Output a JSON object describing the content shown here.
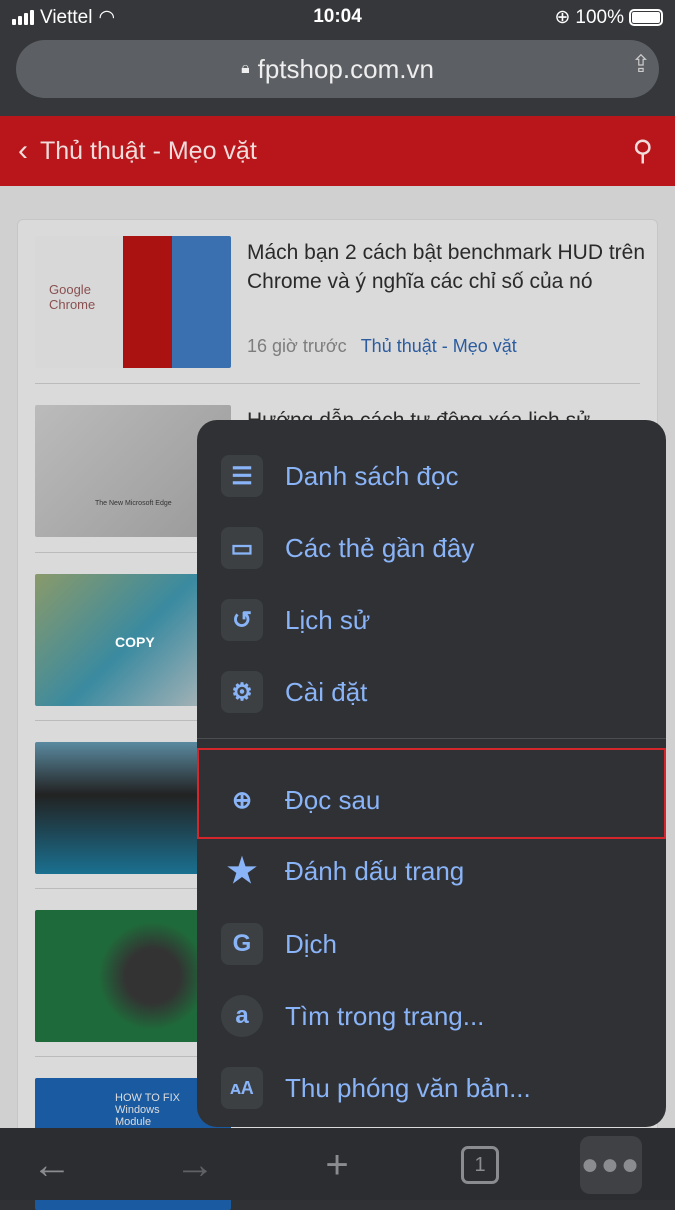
{
  "status": {
    "carrier": "Viettel",
    "time": "10:04",
    "battery": "100%"
  },
  "address": {
    "url": "fptshop.com.vn"
  },
  "header": {
    "title": "Thủ thuật - Mẹo vặt"
  },
  "articles": [
    {
      "title": "Mách bạn 2 cách bật benchmark HUD trên Chrome và ý nghĩa các chỉ số của nó",
      "time": "16 giờ trước",
      "category": "Thủ thuật - Mẹo vặt",
      "thumb_text": "Google Chrome"
    },
    {
      "title": "Hướng dẫn cách tự động xóa lịch sử",
      "thumb_text": "The New Microsoft Edge"
    },
    {
      "title": "",
      "thumb_text": "COPY"
    },
    {
      "title": ""
    },
    {
      "title": ""
    },
    {
      "title": "",
      "thumb_text": "HOW TO FIX Windows Module"
    }
  ],
  "menu": {
    "items": [
      {
        "label": "Danh sách đọc",
        "icon": "list-icon"
      },
      {
        "label": "Các thẻ gần đây",
        "icon": "devices-icon"
      },
      {
        "label": "Lịch sử",
        "icon": "history-icon"
      },
      {
        "label": "Cài đặt",
        "icon": "gear-icon"
      },
      {
        "label": "Đọc sau",
        "icon": "read-later-icon"
      },
      {
        "label": "Đánh dấu trang",
        "icon": "bookmark-star-icon"
      },
      {
        "label": "Dịch",
        "icon": "translate-icon"
      },
      {
        "label": "Tìm trong trang...",
        "icon": "find-icon"
      },
      {
        "label": "Thu phóng văn bản...",
        "icon": "text-zoom-icon"
      }
    ]
  },
  "toolbar": {
    "tab_count": "1"
  },
  "colors": {
    "accent": "#8ab4f8",
    "header": "#cc1417",
    "highlight": "#d4262b"
  }
}
